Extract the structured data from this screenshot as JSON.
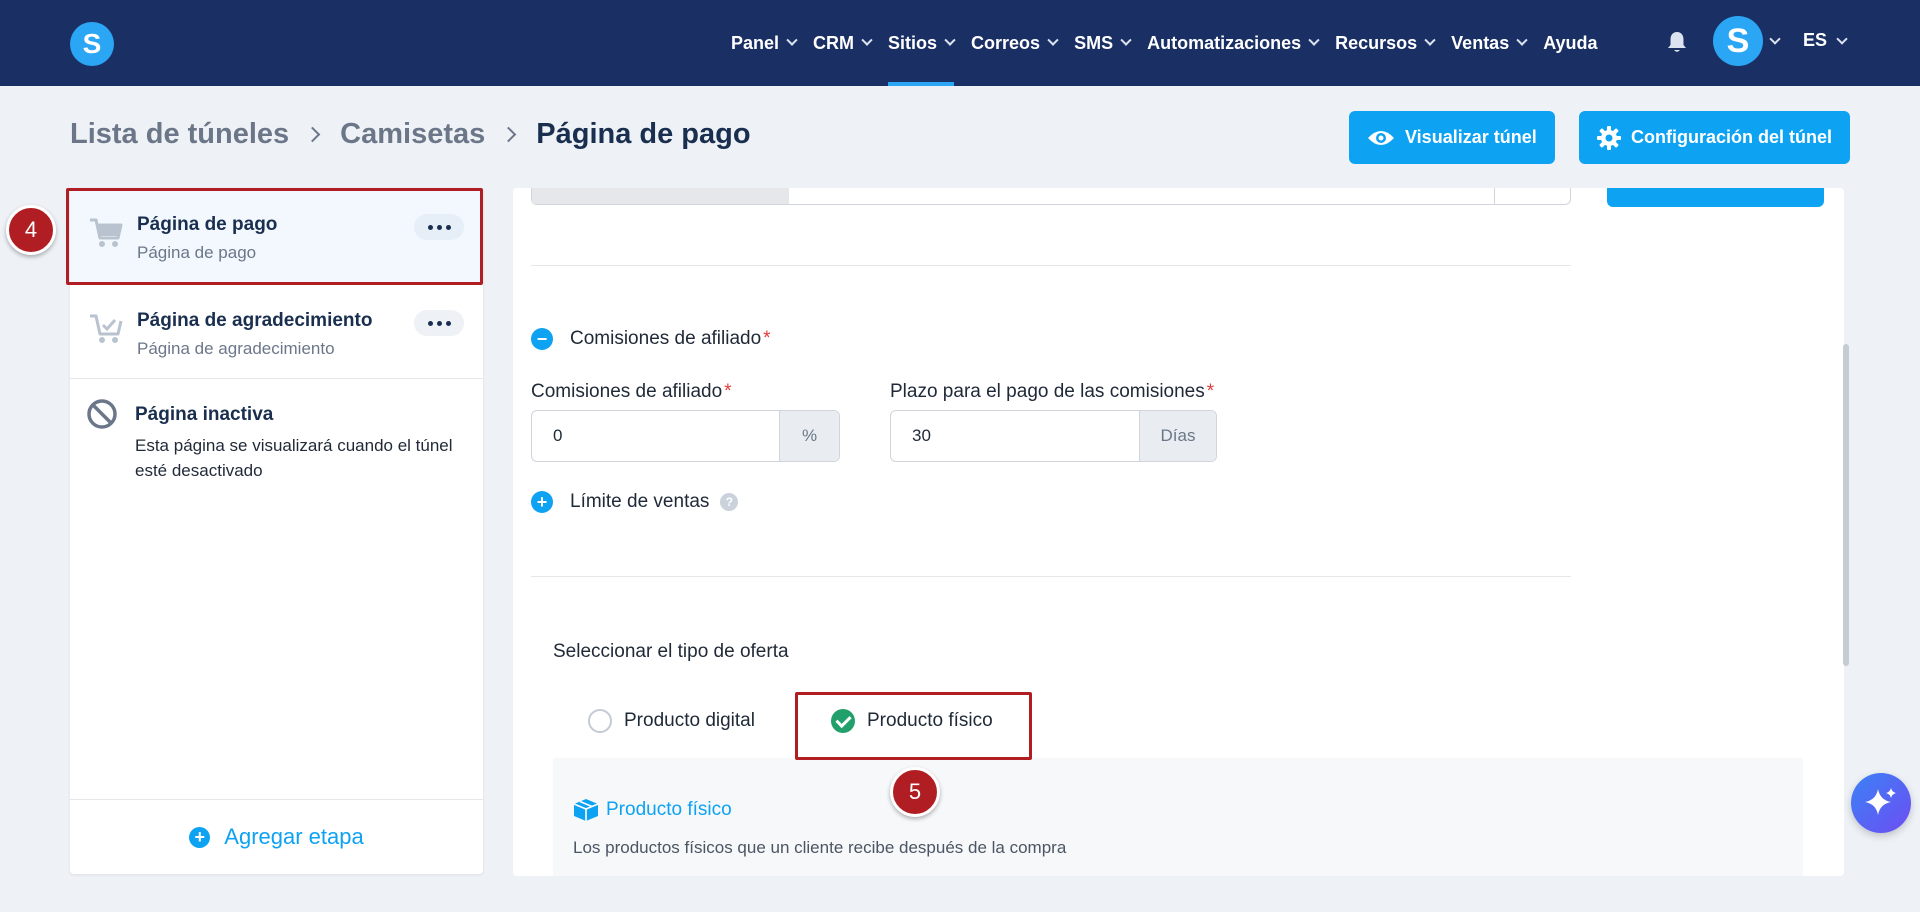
{
  "nav": {
    "items": [
      {
        "label": "Panel",
        "dropdown": true,
        "active": false
      },
      {
        "label": "CRM",
        "dropdown": true,
        "active": false
      },
      {
        "label": "Sitios",
        "dropdown": true,
        "active": true
      },
      {
        "label": "Correos",
        "dropdown": true,
        "active": false
      },
      {
        "label": "SMS",
        "dropdown": true,
        "active": false
      },
      {
        "label": "Automatizaciones",
        "dropdown": true,
        "active": false
      },
      {
        "label": "Recursos",
        "dropdown": true,
        "active": false
      },
      {
        "label": "Ventas",
        "dropdown": true,
        "active": false
      },
      {
        "label": "Ayuda",
        "dropdown": false,
        "active": false
      }
    ],
    "logo_letter": "S",
    "avatar_letter": "S",
    "language": "ES"
  },
  "breadcrumb": {
    "items": [
      "Lista de túneles",
      "Camisetas",
      "Página de pago"
    ]
  },
  "header_buttons": {
    "visualize": "Visualizar túnel",
    "config": "Configuración del túnel"
  },
  "sidebar": {
    "steps": [
      {
        "title": "Página de pago",
        "subtitle": "Página de pago"
      },
      {
        "title": "Página de agradecimiento",
        "subtitle": "Página de agradecimiento"
      }
    ],
    "inactive": {
      "title": "Página inactiva",
      "description": "Esta página se visualizará cuando el túnel esté desactivado"
    },
    "add_step": "Agregar etapa"
  },
  "form": {
    "affiliate_toggle": "Comisiones de afiliado",
    "affiliate_label": "Comisiones de afiliado",
    "affiliate_value": "0",
    "affiliate_unit": "%",
    "term_label": "Plazo para el pago de las comisiones",
    "term_value": "30",
    "term_unit": "Días",
    "sales_limit": "Límite de ventas",
    "required_mark": "*",
    "offer_type_label": "Seleccionar el tipo de oferta",
    "offer_options": [
      "Producto digital",
      "Producto físico"
    ],
    "offer_selected": "Producto físico",
    "physical_title": "Producto físico",
    "physical_description": "Los productos físicos que un cliente recibe después de la compra"
  },
  "markers": [
    "4",
    "5"
  ],
  "colors": {
    "nav_bg": "#1a2f63",
    "accent": "#0ea2f3",
    "success": "#22a06b",
    "highlight": "#b01e23"
  }
}
